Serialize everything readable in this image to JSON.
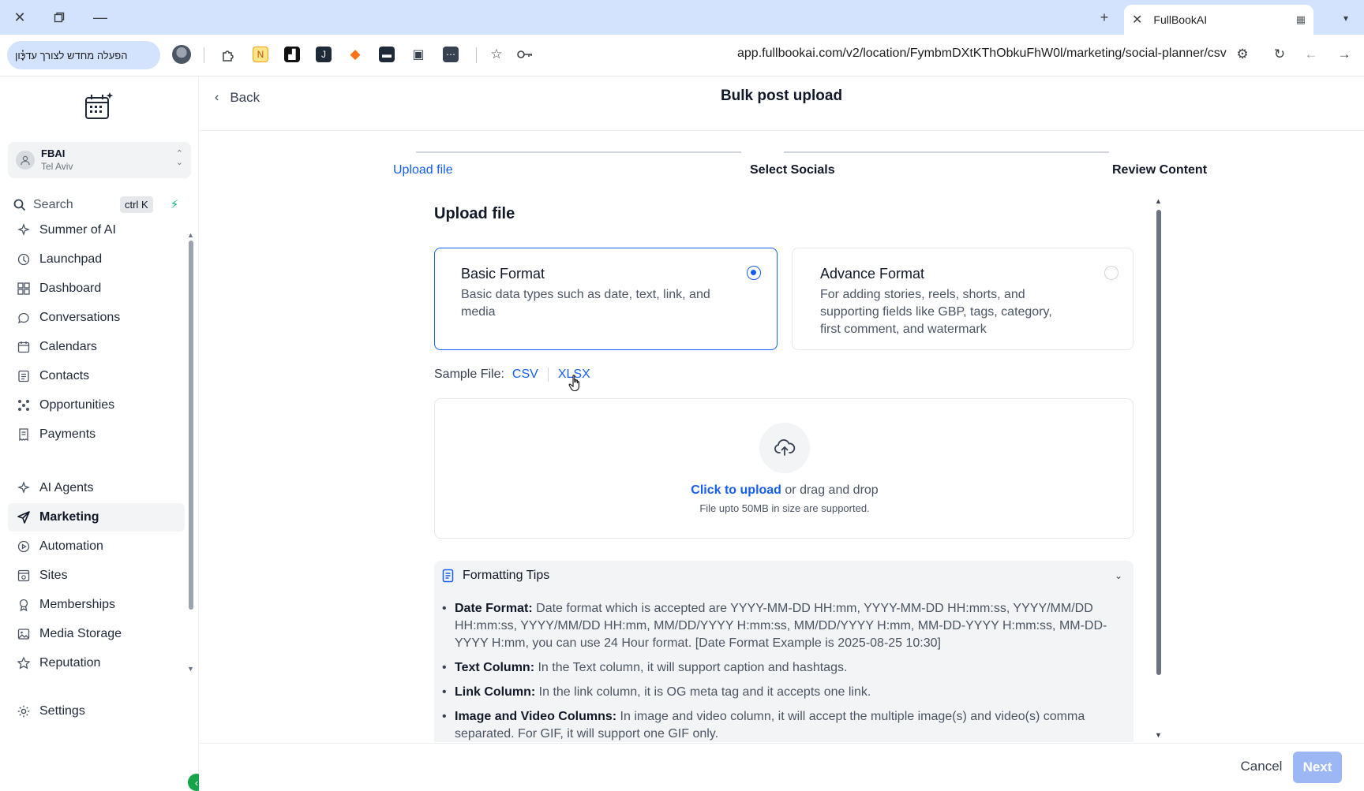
{
  "browser": {
    "tab_title": "FullBookAI",
    "update_pill": "הפעלה מחדש לצורך עדכון",
    "url": "app.fullbookai.com/v2/location/FymbmDXtKThObkuFhW0l/marketing/social-planner/csv"
  },
  "sidebar": {
    "account": {
      "name": "FBAI",
      "location": "Tel Aviv"
    },
    "search": {
      "placeholder": "Search",
      "shortcut": "ctrl K"
    },
    "items_top": [
      {
        "label": "Summer of AI",
        "icon": "sparkle-icon"
      },
      {
        "label": "Launchpad",
        "icon": "rocket-icon"
      },
      {
        "label": "Dashboard",
        "icon": "dashboard-grid-icon"
      },
      {
        "label": "Conversations",
        "icon": "chat-bubble-icon"
      },
      {
        "label": "Calendars",
        "icon": "calendar-icon"
      },
      {
        "label": "Contacts",
        "icon": "contacts-icon"
      },
      {
        "label": "Opportunities",
        "icon": "opportunities-icon"
      },
      {
        "label": "Payments",
        "icon": "receipt-icon"
      }
    ],
    "items_bottom": [
      {
        "label": "AI Agents",
        "icon": "sparkle-icon"
      },
      {
        "label": "Marketing",
        "icon": "send-icon",
        "active": true
      },
      {
        "label": "Automation",
        "icon": "automation-icon"
      },
      {
        "label": "Sites",
        "icon": "sites-icon"
      },
      {
        "label": "Memberships",
        "icon": "award-icon"
      },
      {
        "label": "Media Storage",
        "icon": "image-icon"
      },
      {
        "label": "Reputation",
        "icon": "star-icon"
      }
    ],
    "settings_label": "Settings"
  },
  "header": {
    "back_label": "Back",
    "title": "Bulk post upload"
  },
  "steps": [
    {
      "label": "Upload file",
      "state": "active"
    },
    {
      "label": "Select Socials",
      "state": "upcoming"
    },
    {
      "label": "Review Content",
      "state": "upcoming"
    }
  ],
  "upload": {
    "heading": "Upload file",
    "formats": [
      {
        "name": "Basic Format",
        "description": "Basic data types such as date, text, link, and media",
        "selected": true
      },
      {
        "name": "Advance Format",
        "description": "For adding stories, reels, shorts, and supporting fields like GBP, tags, category, first comment, and watermark",
        "selected": false
      }
    ],
    "sample_label": "Sample File:",
    "sample_csv": "CSV",
    "sample_xlsx": "XLSX",
    "dropzone": {
      "link_text": "Click to upload",
      "rest_text": " or drag and drop",
      "hint": "File upto 50MB in size are supported."
    }
  },
  "tips": {
    "title": "Formatting Tips",
    "items": [
      {
        "term": "Date Format:",
        "text": " Date format which is accepted are YYYY-MM-DD HH:mm, YYYY-MM-DD HH:mm:ss, YYYY/MM/DD HH:mm:ss, YYYY/MM/DD HH:mm, MM/DD/YYYY H:mm:ss, MM/DD/YYYY H:mm, MM-DD-YYYY H:mm:ss, MM-DD-YYYY H:mm, you can use 24 Hour format. [Date Format Example is 2025-08-25 10:30]"
      },
      {
        "term": "Text Column:",
        "text": " In the Text column, it will support caption and hashtags."
      },
      {
        "term": "Link Column:",
        "text": " In the link column, it is OG meta tag and it accepts one link."
      },
      {
        "term": "Image and Video Columns:",
        "text": " In image and video column, it will accept the multiple image(s) and video(s) comma separated. For GIF, it will support one GIF only."
      }
    ]
  },
  "footer": {
    "cancel_label": "Cancel",
    "next_label": "Next"
  },
  "colors": {
    "accent": "#155eef",
    "next_disabled": "#9db7f5",
    "sidebar_collapse": "#16a34a"
  }
}
